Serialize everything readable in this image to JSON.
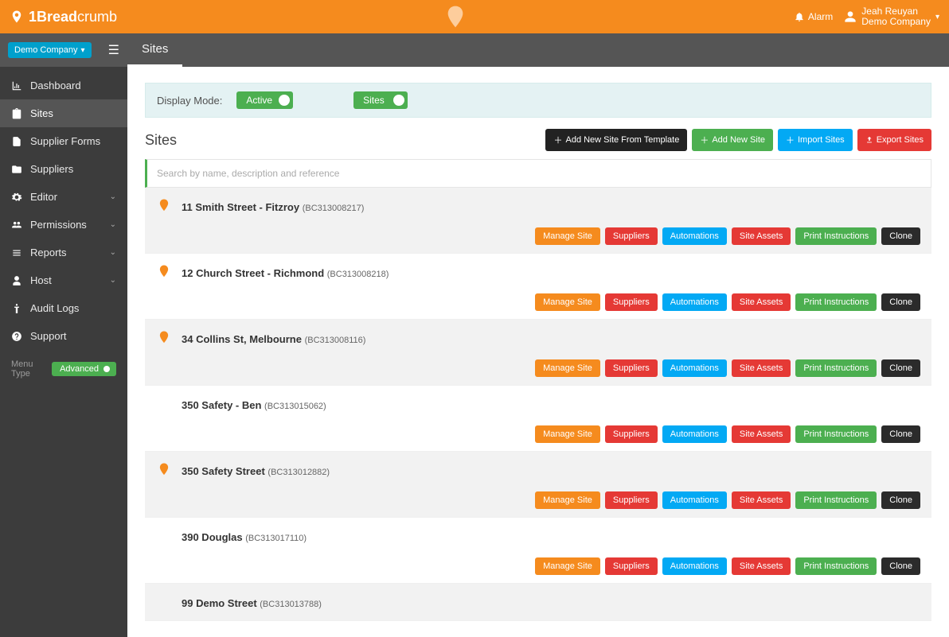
{
  "brand": {
    "bold": "1Bread",
    "thin": "crumb"
  },
  "alarm_label": "Alarm",
  "user": {
    "name": "Jeah Reuyan",
    "company": "Demo Company"
  },
  "company_pill": "Demo Company",
  "page_tab": "Sites",
  "sidebar": {
    "items": [
      {
        "label": "Dashboard",
        "icon": "chart"
      },
      {
        "label": "Sites",
        "icon": "clipboard",
        "active": true
      },
      {
        "label": "Supplier Forms",
        "icon": "file"
      },
      {
        "label": "Suppliers",
        "icon": "folder"
      },
      {
        "label": "Editor",
        "icon": "gear",
        "chev": true
      },
      {
        "label": "Permissions",
        "icon": "users",
        "chev": true
      },
      {
        "label": "Reports",
        "icon": "list",
        "chev": true
      },
      {
        "label": "Host",
        "icon": "person",
        "chev": true
      },
      {
        "label": "Audit Logs",
        "icon": "body"
      },
      {
        "label": "Support",
        "icon": "question"
      }
    ],
    "menu_type_label": "Menu Type",
    "menu_type_value": "Advanced"
  },
  "display_mode": {
    "label": "Display Mode:",
    "toggle1": "Active",
    "toggle2": "Sites"
  },
  "section_title": "Sites",
  "header_buttons": {
    "add_from_template": "Add New Site From Template",
    "add_new": "Add New Site",
    "import": "Import Sites",
    "export": "Export Sites"
  },
  "search_placeholder": "Search by name, description and reference",
  "row_buttons": {
    "manage": "Manage Site",
    "suppliers": "Suppliers",
    "automations": "Automations",
    "assets": "Site Assets",
    "print": "Print Instructions",
    "clone": "Clone"
  },
  "sites": [
    {
      "name": "11 Smith Street - Fitzroy",
      "ref": "(BC313008217)",
      "alt": true,
      "logo": true
    },
    {
      "name": "12 Church Street - Richmond",
      "ref": "(BC313008218)",
      "alt": false,
      "logo": true
    },
    {
      "name": "34 Collins St, Melbourne",
      "ref": "(BC313008116)",
      "alt": true,
      "logo": true
    },
    {
      "name": "350 Safety - Ben",
      "ref": "(BC313015062)",
      "alt": false,
      "logo": false
    },
    {
      "name": "350 Safety Street",
      "ref": "(BC313012882)",
      "alt": true,
      "logo": true
    },
    {
      "name": "390 Douglas",
      "ref": "(BC313017110)",
      "alt": false,
      "logo": false
    },
    {
      "name": "99 Demo Street",
      "ref": "(BC313013788)",
      "alt": true,
      "logo": false
    }
  ]
}
